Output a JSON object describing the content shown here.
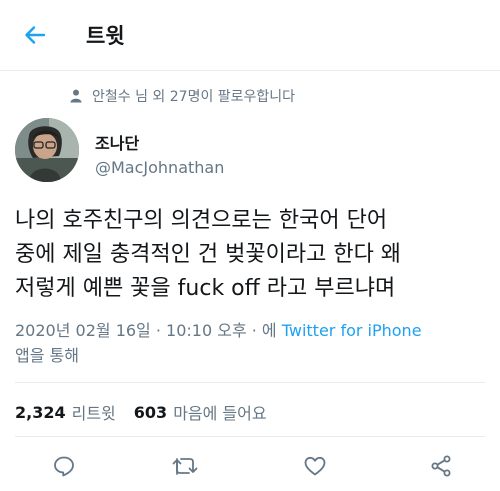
{
  "header": {
    "title": "트윗",
    "back_icon": "arrow-left-icon"
  },
  "context": {
    "icon": "person-icon",
    "text": "안철수 님 외 27명이 팔로우합니다"
  },
  "author": {
    "name": "조나단",
    "handle": "@MacJohnathan"
  },
  "tweet": {
    "text": "나의 호주친구의 의견으로는 한국어 단어\n중에 제일 충격적인 건 벚꽃이라고 한다 왜\n저렇게 예쁜 꽃을 fuck off 라고 부르냐며"
  },
  "meta": {
    "timestamp": "2020년 02월 16일 · 10:10 오후 · 에 ",
    "source": "Twitter for iPhone",
    "suffix": "앱을 통해"
  },
  "stats": {
    "retweets_count": "2,324",
    "retweets_label": "리트윗",
    "likes_count": "603",
    "likes_label": "마음에 들어요"
  },
  "actions": [
    "reply-icon",
    "retweet-icon",
    "like-icon",
    "share-icon"
  ],
  "colors": {
    "accent": "#1da1f2",
    "secondary_text": "#657786",
    "primary_text": "#14171a",
    "divider": "#e6ecf0"
  }
}
